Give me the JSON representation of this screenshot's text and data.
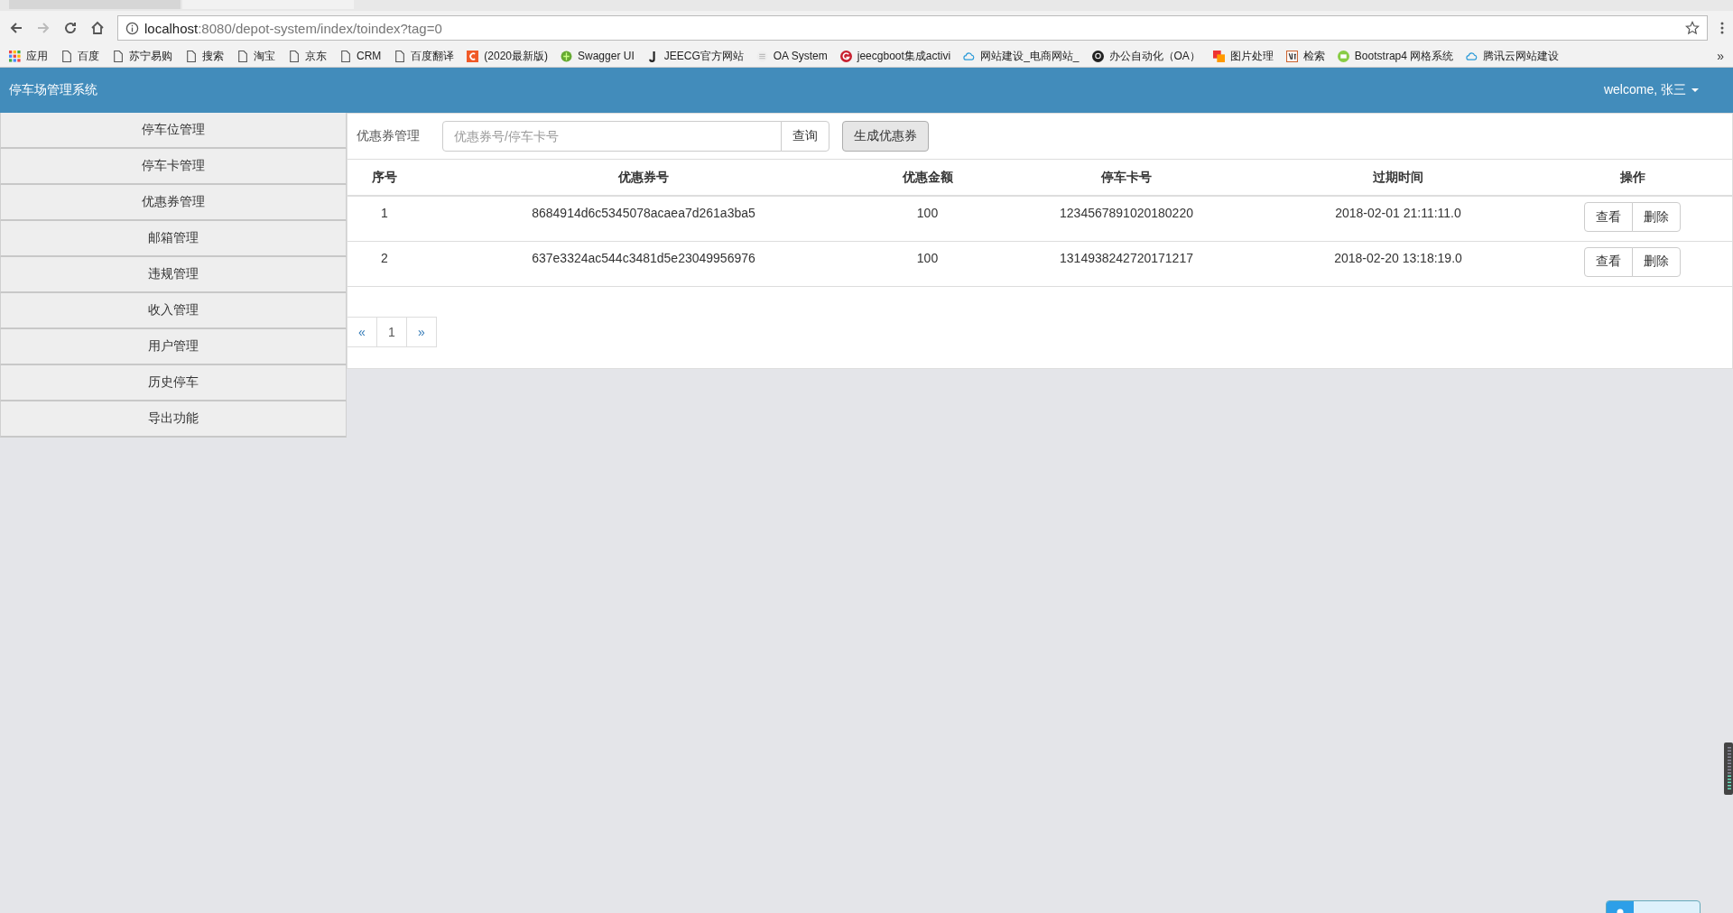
{
  "browser": {
    "tabs": [
      {
        "selected": false
      },
      {
        "selected": true
      }
    ],
    "address": {
      "host": "localhost",
      "rest": ":8080/depot-system/index/toindex?tag=0"
    },
    "bookmarks": [
      {
        "label": "应用",
        "kind": "apps"
      },
      {
        "label": "百度",
        "kind": "page"
      },
      {
        "label": "苏宁易购",
        "kind": "page"
      },
      {
        "label": "搜索",
        "kind": "page"
      },
      {
        "label": "淘宝",
        "kind": "page"
      },
      {
        "label": "京东",
        "kind": "page"
      },
      {
        "label": "CRM",
        "kind": "page"
      },
      {
        "label": "百度翻译",
        "kind": "page"
      },
      {
        "label": "(2020最新版)",
        "kind": "c"
      },
      {
        "label": "Swagger UI",
        "kind": "swagger"
      },
      {
        "label": "JEECG官方网站",
        "kind": "j"
      },
      {
        "label": "OA System",
        "kind": "doc"
      },
      {
        "label": "jeecgboot集成activi",
        "kind": "g"
      },
      {
        "label": "网站建设_电商网站_",
        "kind": "cloud"
      },
      {
        "label": "办公自动化（OA）",
        "kind": "github"
      },
      {
        "label": "图片处理",
        "kind": "img"
      },
      {
        "label": "检索",
        "kind": "zhi"
      },
      {
        "label": "Bootstrap4 网格系统",
        "kind": "code"
      },
      {
        "label": "腾讯云网站建设",
        "kind": "cloud"
      }
    ],
    "more": "»"
  },
  "navbar": {
    "brand": "停车场管理系统",
    "user": "welcome, 张三"
  },
  "sidebar": {
    "items": [
      {
        "label": "停车位管理"
      },
      {
        "label": "停车卡管理"
      },
      {
        "label": "优惠券管理"
      },
      {
        "label": "邮箱管理"
      },
      {
        "label": "违规管理"
      },
      {
        "label": "收入管理"
      },
      {
        "label": "用户管理"
      },
      {
        "label": "历史停车"
      },
      {
        "label": "导出功能"
      }
    ]
  },
  "toolbar": {
    "label": "优惠券管理",
    "search": {
      "placeholder": "优惠券号/停车卡号"
    },
    "query_button": "查询",
    "generate_button": "生成优惠券"
  },
  "table": {
    "columns": [
      "序号",
      "优惠券号",
      "优惠金额",
      "停车卡号",
      "过期时间",
      "操作"
    ],
    "rows": [
      {
        "cells": [
          "1",
          "8684914d6c5345078acaea7d261a3ba5",
          "100",
          "1234567891020180220",
          "2018-02-01 21:11:11.0"
        ],
        "actions": [
          "查看",
          "删除"
        ]
      },
      {
        "cells": [
          "2",
          "637e3324ac544c3481d5e23049956976",
          "100",
          "1314938242720171217",
          "2018-02-20 13:18:19.0"
        ],
        "actions": [
          "查看",
          "删除"
        ]
      }
    ]
  },
  "pagination": [
    {
      "label": "«",
      "kind": "prev"
    },
    {
      "label": "1",
      "kind": "page"
    },
    {
      "label": "»",
      "kind": "next"
    }
  ]
}
